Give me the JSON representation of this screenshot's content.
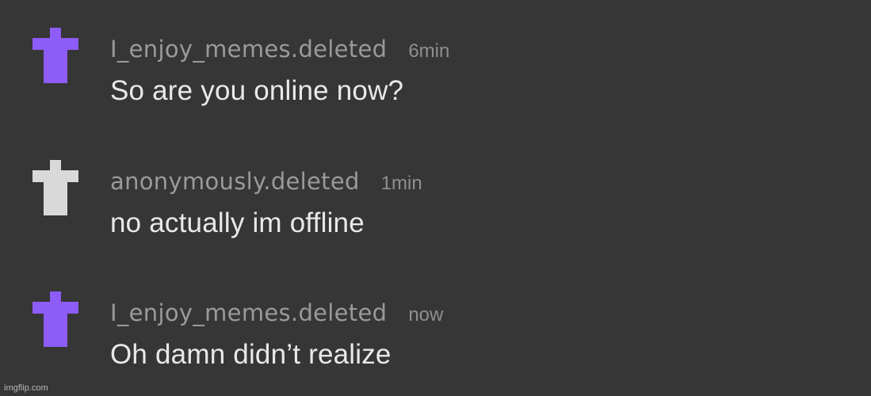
{
  "comments": [
    {
      "username": "I_enjoy_memes.deleted",
      "time": "6min",
      "message": "So are you online now?",
      "avatar_color": "#8e5cf7"
    },
    {
      "username": "anonymously.deleted",
      "time": "1min",
      "message": "no actually im offline",
      "avatar_color": "#d9d9d9"
    },
    {
      "username": "I_enjoy_memes.deleted",
      "time": "now",
      "message": "Oh damn didn’t realize",
      "avatar_color": "#8e5cf7"
    }
  ],
  "watermark": "imgflip.com",
  "colors": {
    "background": "#363636",
    "username": "#9a9a9a",
    "message": "#e9e9e9"
  }
}
